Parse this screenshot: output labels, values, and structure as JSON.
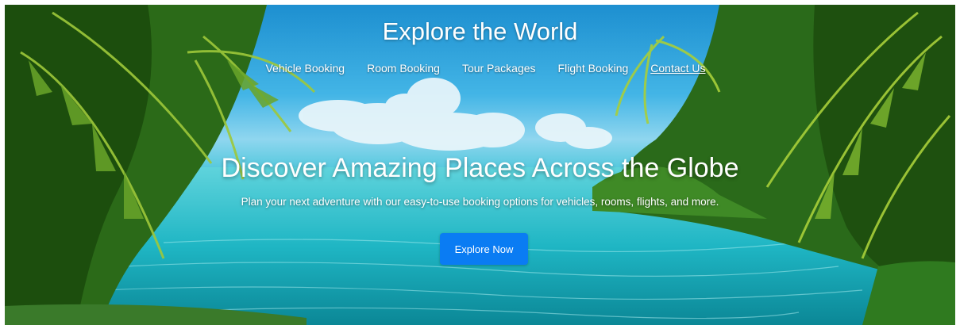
{
  "header": {
    "title": "Explore the World"
  },
  "nav": {
    "items": [
      {
        "label": "Vehicle Booking"
      },
      {
        "label": "Room Booking"
      },
      {
        "label": "Tour Packages"
      },
      {
        "label": "Flight Booking"
      },
      {
        "label": "Contact Us"
      }
    ]
  },
  "hero": {
    "headline": "Discover Amazing Places Across the Globe",
    "subheadline": "Plan your next adventure with our easy-to-use booking options for vehicles, rooms, flights, and more.",
    "cta_label": "Explore Now"
  },
  "colors": {
    "cta_background": "#0a7cf3",
    "text": "#ffffff",
    "water": "#19b0bf",
    "foliage": "#2f7a1f"
  }
}
